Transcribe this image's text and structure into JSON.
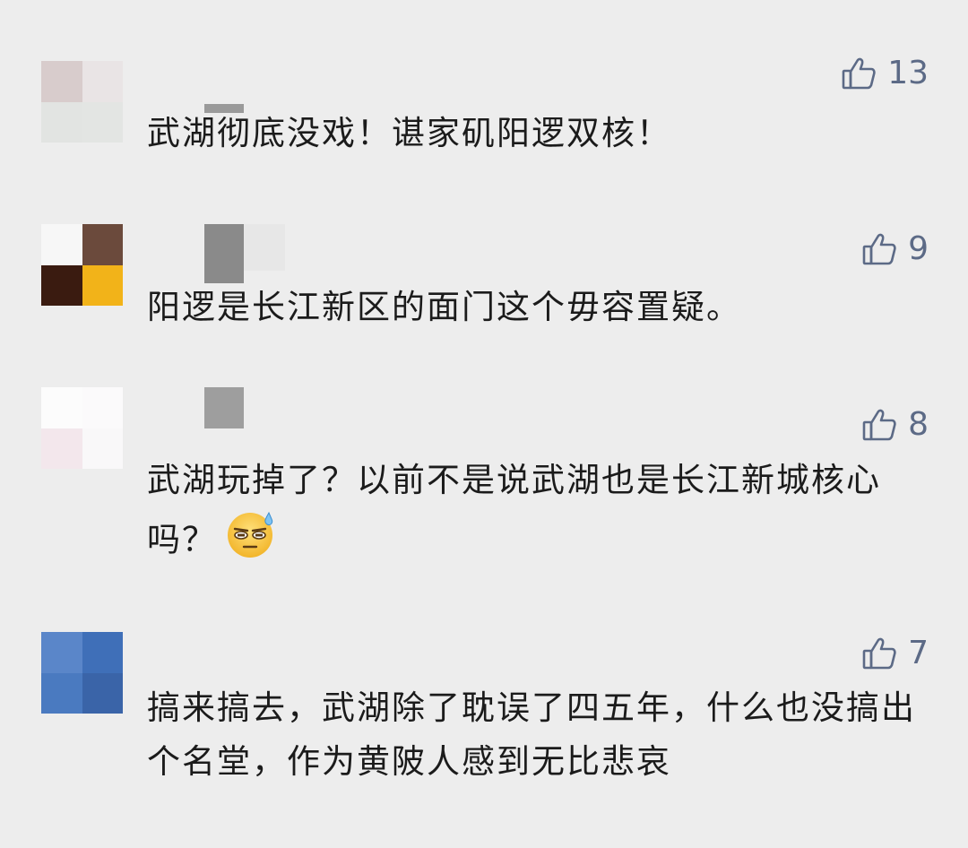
{
  "comments": [
    {
      "likes": "13",
      "text": "武湖彻底没戏！谌家矶阳逻双核！",
      "colors": [
        "#d8cccc",
        "#e9e4e5",
        "#e2e4e2",
        "#e3e5e3"
      ]
    },
    {
      "likes": "9",
      "text": "阳逻是长江新区的面门这个毋容置疑。",
      "colors": [
        "#f7f7f7",
        "#6b4a3c",
        "#3a1b10",
        "#f2b319"
      ]
    },
    {
      "likes": "8",
      "text": "武湖玩掉了？以前不是说武湖也是长江新城核心吗？",
      "emoji": "sweat-smile-emoji",
      "colors": [
        "#fcfcfc",
        "#fbfafb",
        "#f3e7ec",
        "#f9f8f9"
      ]
    },
    {
      "likes": "7",
      "text": "搞来搞去，武湖除了耽误了四五年，什么也没搞出个名堂，作为黄陂人感到无比悲哀",
      "colors": [
        "#5a86c9",
        "#3f6fb8",
        "#4a7ac0",
        "#3a64a8"
      ]
    }
  ],
  "like_icon": "thumbs-up-icon",
  "accent_color": "#5c6a86"
}
